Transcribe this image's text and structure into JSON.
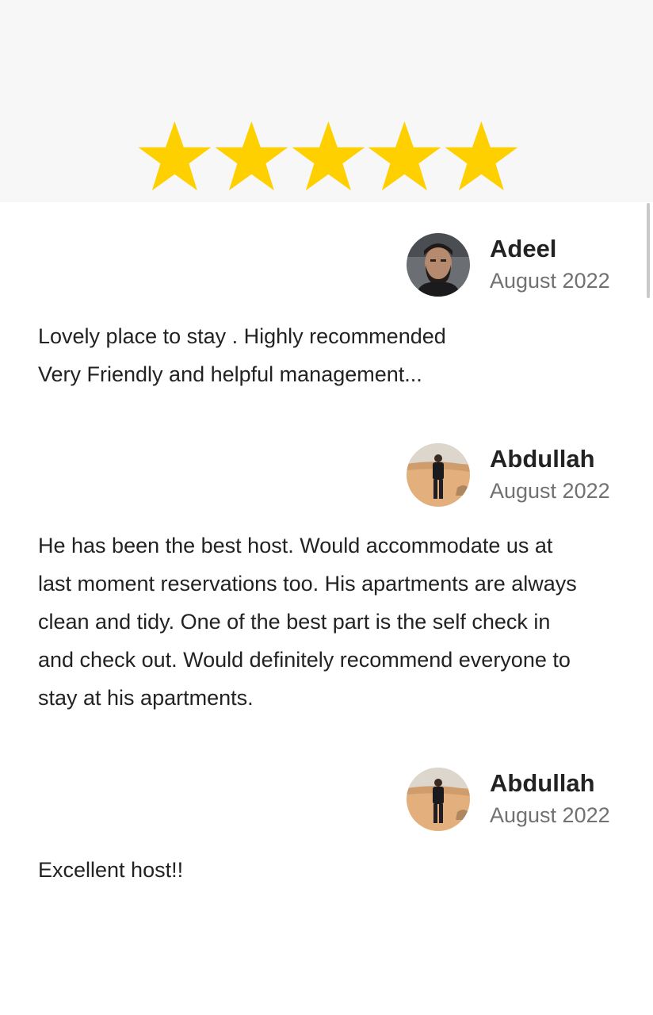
{
  "rating": {
    "stars": 5,
    "max_stars": 5,
    "star_color": "#ffd000",
    "icon": "star-icon"
  },
  "reviews": [
    {
      "name": "Adeel",
      "date": "August 2022",
      "avatar": "avatar-adeel",
      "text": "Lovely place to stay . Highly recommended\nVery Friendly and helpful management..."
    },
    {
      "name": "Abdullah",
      "date": "August 2022",
      "avatar": "avatar-abdullah",
      "text": "He has been the best host. Would accommodate us at\nlast moment reservations too. His apartments are always\nclean and tidy. One of the best part is the self check in\nand check out. Would definitely recommend everyone to\nstay at his apartments."
    },
    {
      "name": "Abdullah",
      "date": "August 2022",
      "avatar": "avatar-abdullah",
      "text": "Excellent host!!"
    }
  ]
}
